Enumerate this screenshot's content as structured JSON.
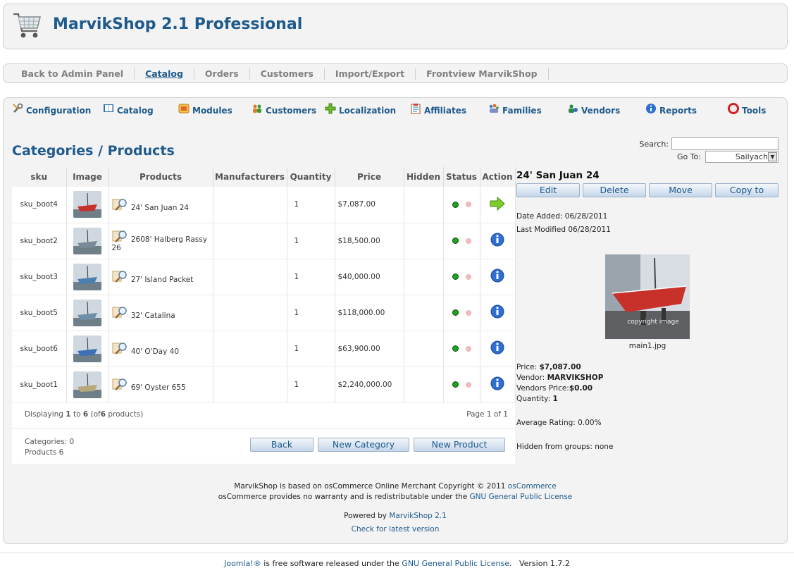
{
  "app": {
    "title": "MarvikShop 2.1 Professional"
  },
  "topnav": [
    "Back to Admin Panel",
    "Catalog",
    "Orders",
    "Customers",
    "Import/Export",
    "Frontview MarvikShop"
  ],
  "toolbar": [
    {
      "label": "Configuration",
      "icon": "wrench-icon"
    },
    {
      "label": "Catalog",
      "icon": "book-icon"
    },
    {
      "label": "Modules",
      "icon": "modules-icon"
    },
    {
      "label": "Customers",
      "icon": "users-icon"
    },
    {
      "label": "Localization",
      "icon": "plus-icon"
    },
    {
      "label": "Affiliates",
      "icon": "clipboard-icon"
    },
    {
      "label": "Families",
      "icon": "family-icon"
    },
    {
      "label": "Vendors",
      "icon": "vendor-icon"
    },
    {
      "label": "Reports",
      "icon": "info-icon"
    },
    {
      "label": "Tools",
      "icon": "lifebuoy-icon"
    }
  ],
  "page": {
    "heading": "Categories / Products"
  },
  "search": {
    "label": "Search:",
    "value": "",
    "goto_label": "Go To:",
    "goto_value": "Sailyachts"
  },
  "columns": [
    "sku",
    "Image",
    "Products",
    "Manufacturers",
    "Quantity",
    "Price",
    "Hidden",
    "Status",
    "Action"
  ],
  "rows": [
    {
      "sku": "sku_boot4",
      "product": "24' San Juan 24",
      "manufacturer": "",
      "quantity": "1",
      "price": "$7,087.00",
      "hidden": "",
      "action": "arrow-right-icon",
      "thumb_color": "#c8302a"
    },
    {
      "sku": "sku_boot2",
      "product": "2608' Halberg Rassy 26",
      "manufacturer": "",
      "quantity": "1",
      "price": "$18,500.00",
      "hidden": "",
      "action": "info-icon",
      "thumb_color": "#7a8a96"
    },
    {
      "sku": "sku_boot3",
      "product": "27' Island Packet",
      "manufacturer": "",
      "quantity": "1",
      "price": "$40,000.00",
      "hidden": "",
      "action": "info-icon",
      "thumb_color": "#4d7fae"
    },
    {
      "sku": "sku_boot5",
      "product": "32' Catalina",
      "manufacturer": "",
      "quantity": "1",
      "price": "$118,000.00",
      "hidden": "",
      "action": "info-icon",
      "thumb_color": "#6f8ea8"
    },
    {
      "sku": "sku_boot6",
      "product": "40' O'Day 40",
      "manufacturer": "",
      "quantity": "1",
      "price": "$63,900.00",
      "hidden": "",
      "action": "info-icon",
      "thumb_color": "#3c6fb5"
    },
    {
      "sku": "sku_boot1",
      "product": "69' Oyster 655",
      "manufacturer": "",
      "quantity": "1",
      "price": "$2,240,000.00",
      "hidden": "",
      "action": "info-icon",
      "thumb_color": "#b7a77c"
    }
  ],
  "pagination": {
    "displaying_prefix": "Displaying",
    "from": "1",
    "to_word": "to",
    "to": "6",
    "of_prefix": "(of",
    "total": "6",
    "suffix": "products)",
    "page": "Page 1 of 1"
  },
  "counts": {
    "categories": "Categories: 0",
    "products": "Products 6"
  },
  "buttons": {
    "back": "Back",
    "new_category": "New Category",
    "new_product": "New Product"
  },
  "detail": {
    "name": "24' San Juan 24",
    "actions": [
      "Edit",
      "Delete",
      "Move",
      "Copy to"
    ],
    "date_added": "Date Added: 06/28/2011",
    "last_modified": "Last Modified 06/28/2011",
    "image_caption": "main1.jpg",
    "image_overlay": "copyright image",
    "price_label": "Price:",
    "price": "$7,087.00",
    "vendor_label": "Vendor:",
    "vendor": "MARVIKSHOP",
    "vendors_price_label": "Vendors Price:",
    "vendors_price": "$0.00",
    "quantity_label": "Quantity:",
    "quantity": "1",
    "rating": "Average Rating: 0.00%",
    "hidden_groups": "Hidden from groups: none"
  },
  "footer": {
    "line1_text": "MarvikShop is based on osCommerce Online Merchant Copyright © 2011",
    "line1_link": "osCommerce",
    "line2_text": "osCommerce provides no warranty and is redistributable under the",
    "line2_link": "GNU General Public License",
    "powered_text": "Powered by",
    "powered_link": "MarvikShop 2.1",
    "check": "Check for latest version"
  },
  "bottom": {
    "joomla_link": "Joomla!®",
    "text": "is free software released under the",
    "license_link": "GNU General Public License",
    "version": "Version 1.7.2"
  },
  "colors": {
    "brand_blue": "#1e5a8c",
    "status_green": "#1fa31f",
    "status_red": "#f2b9b9"
  }
}
